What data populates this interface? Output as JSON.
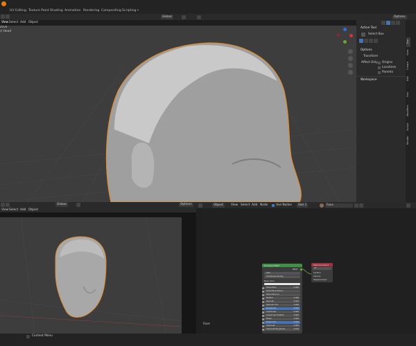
{
  "workspace_tabs": [
    "UV Editing",
    "Texture Paint",
    "Shading",
    "Animation",
    "Rendering",
    "Compositing",
    "Scripting",
    "+"
  ],
  "top_viewport": {
    "menu": [
      "View",
      "Select",
      "Add",
      "Object"
    ],
    "overlay_lines": [
      "ctive",
      "r) Head"
    ],
    "orientation": "Global",
    "options_label": "Options",
    "side_tabs": [
      "Tool",
      "View",
      "Create",
      "Edit",
      "Hair",
      "Modifiers",
      "Sculpt",
      "Render"
    ],
    "panel": {
      "active_tool_header": "Active Tool",
      "select_box": "Select Box",
      "options_header": "Options",
      "transform_header": "Transform",
      "affect_only": "Affect Only",
      "origins": "Origins",
      "locations": "Locations",
      "parents": "Parents",
      "workspace_header": "Workspace"
    }
  },
  "bottom_left_viewport": {
    "menu": [
      "View",
      "Select",
      "Add",
      "Object"
    ],
    "orientation": "Global",
    "options_label": "Options"
  },
  "node_editor": {
    "mode": "Object",
    "menu": [
      "View",
      "Select",
      "Add",
      "Node"
    ],
    "use_nodes": "Use Nodes",
    "slot": "Slot 1",
    "material": "Face",
    "frame_label": "Face",
    "bsdf": {
      "title": "Principled BSDF",
      "output": "BSDF",
      "distribution": "GGX",
      "subsurface_method": "Christensen-Burley",
      "base_color": "Base Color",
      "rows": [
        {
          "label": "Subsurface",
          "value": "0.000"
        },
        {
          "label": "Subsurface Radius",
          "value": ""
        },
        {
          "label": "Subsurface Co",
          "value": ""
        },
        {
          "label": "Metallic",
          "value": "0.000"
        },
        {
          "label": "Specular",
          "value": "0.500"
        },
        {
          "label": "Specular Tint",
          "value": "0.000"
        },
        {
          "label": "Roughness",
          "value": "0.500"
        },
        {
          "label": "Anisotropic",
          "value": "0.000"
        },
        {
          "label": "Anisotropic Rotation",
          "value": "0.000"
        },
        {
          "label": "Sheen",
          "value": "0.000"
        },
        {
          "label": "Sheen Tint",
          "value": "0.500"
        },
        {
          "label": "Clearcoat",
          "value": "0.000"
        },
        {
          "label": "Clearcoat Roughness",
          "value": "0.030"
        }
      ]
    },
    "output_node": {
      "title": "Material Output",
      "target": "All",
      "sockets": [
        "Surface",
        "Volume",
        "Displacement"
      ]
    }
  },
  "status_bar": {
    "context_menu": "Context Menu"
  }
}
